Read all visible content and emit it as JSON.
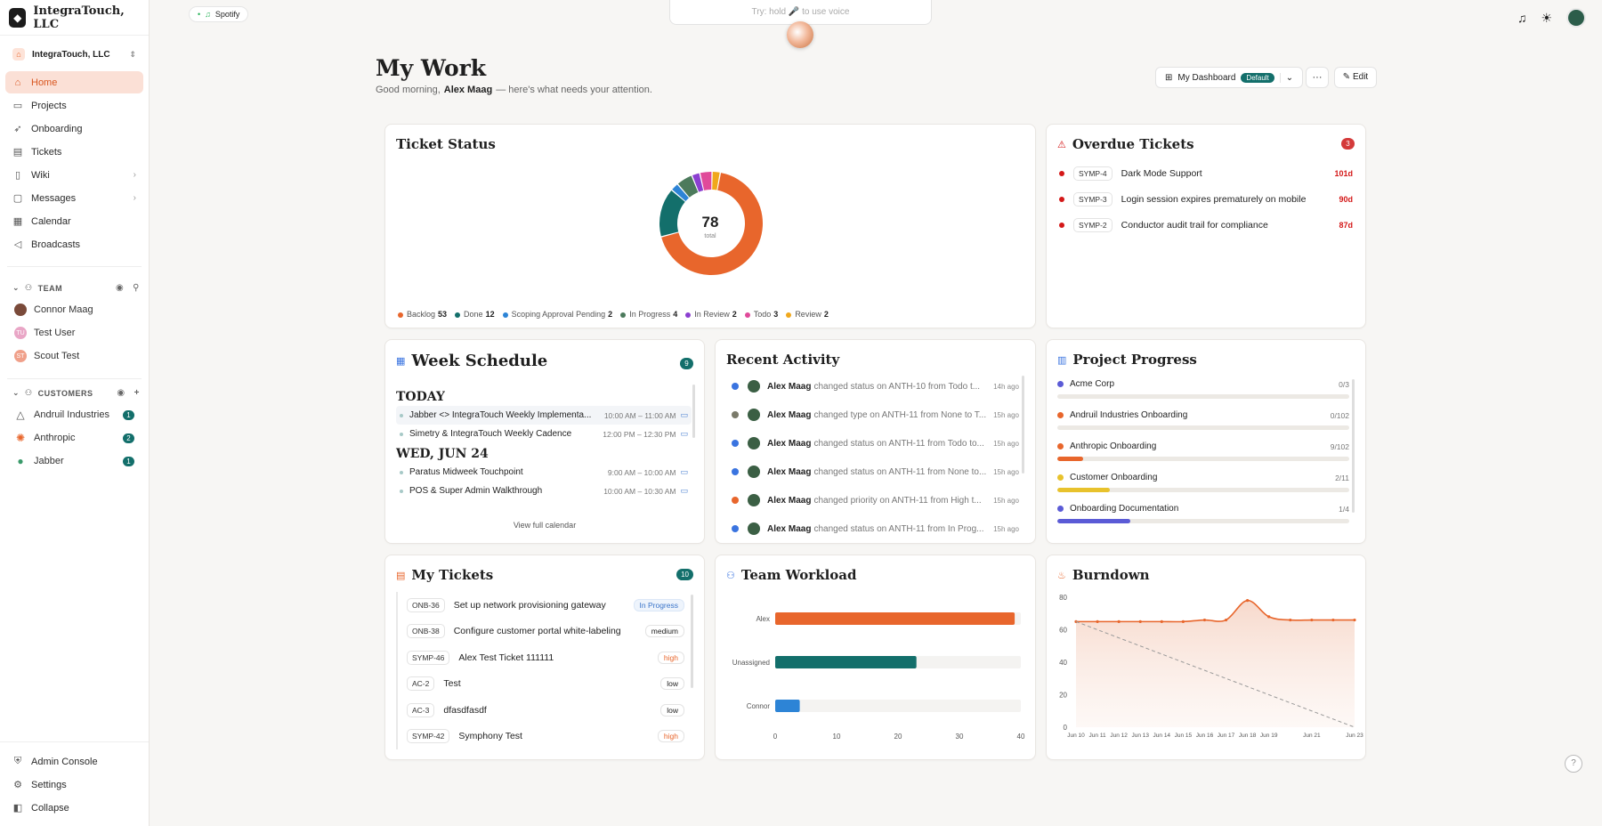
{
  "brand": {
    "name": "IntegraTouch, LLC"
  },
  "org": {
    "name": "IntegraTouch, LLC"
  },
  "nav": [
    {
      "label": "Home",
      "icon": "home-icon",
      "active": true
    },
    {
      "label": "Projects",
      "icon": "folder-icon"
    },
    {
      "label": "Onboarding",
      "icon": "rocket-icon"
    },
    {
      "label": "Tickets",
      "icon": "ticket-icon"
    },
    {
      "label": "Wiki",
      "icon": "book-icon",
      "arrow": true
    },
    {
      "label": "Messages",
      "icon": "message-icon",
      "arrow": true
    },
    {
      "label": "Calendar",
      "icon": "calendar-icon"
    },
    {
      "label": "Broadcasts",
      "icon": "megaphone-icon"
    }
  ],
  "team": {
    "label": "TEAM",
    "members": [
      {
        "name": "Connor Maag"
      },
      {
        "name": "Test User",
        "initials": "TU"
      },
      {
        "name": "Scout Test",
        "initials": "ST"
      }
    ]
  },
  "customers": {
    "label": "CUSTOMERS",
    "items": [
      {
        "name": "Andruil Industries",
        "count": "1"
      },
      {
        "name": "Anthropic",
        "count": "2"
      },
      {
        "name": "Jabber",
        "count": "1"
      }
    ]
  },
  "bottom_nav": [
    {
      "label": "Admin Console"
    },
    {
      "label": "Settings"
    },
    {
      "label": "Collapse"
    }
  ],
  "topbar": {
    "spotify": "Spotify",
    "voice_hint": "Try: hold 🎤 to use voice"
  },
  "header": {
    "title": "My Work",
    "greeting_pre": "Good morning,",
    "user": "Alex Maag",
    "greeting_post": "— here's what needs your attention.",
    "dashboard": "My Dashboard",
    "default": "Default",
    "more": "···",
    "edit": "Edit"
  },
  "ticket_status": {
    "title": "Ticket Status",
    "total": "78",
    "total_label": "total",
    "legend": [
      {
        "label": "Backlog",
        "count": "53",
        "color": "#e8662c"
      },
      {
        "label": "Done",
        "count": "12",
        "color": "#136f6b"
      },
      {
        "label": "Scoping Approval Pending",
        "count": "2",
        "color": "#2d84d6"
      },
      {
        "label": "In Progress",
        "count": "4",
        "color": "#4c7a5c"
      },
      {
        "label": "In Review",
        "count": "2",
        "color": "#8b3fd0"
      },
      {
        "label": "Todo",
        "count": "3",
        "color": "#e04a9a"
      },
      {
        "label": "Review",
        "count": "2",
        "color": "#f0a81c"
      }
    ]
  },
  "overdue": {
    "title": "Overdue Tickets",
    "count": "3",
    "items": [
      {
        "id": "SYMP-4",
        "title": "Dark Mode Support",
        "days": "101d"
      },
      {
        "id": "SYMP-3",
        "title": "Login session expires prematurely on mobile",
        "days": "90d"
      },
      {
        "id": "SYMP-2",
        "title": "Conductor audit trail for compliance",
        "days": "87d"
      }
    ]
  },
  "schedule": {
    "title": "Week Schedule",
    "count": "9",
    "days": [
      {
        "label": "TODAY",
        "events": [
          {
            "title": "Jabber <> IntegraTouch Weekly Implementa...",
            "time": "10:00 AM – 11:00 AM"
          },
          {
            "title": "Simetry & IntegraTouch Weekly Cadence",
            "time": "12:00 PM – 12:30 PM"
          }
        ]
      },
      {
        "label": "WED, JUN 24",
        "events": [
          {
            "title": "Paratus Midweek Touchpoint",
            "time": "9:00 AM – 10:00 AM"
          },
          {
            "title": "POS & Super Admin Walkthrough",
            "time": "10:00 AM – 10:30 AM"
          }
        ]
      }
    ],
    "view_all": "View full calendar"
  },
  "activity": {
    "title": "Recent Activity",
    "items": [
      {
        "user": "Alex Maag",
        "text": "changed status on ANTH-10 from Todo t...",
        "time": "14h ago",
        "color": "#3a74e0"
      },
      {
        "user": "Alex Maag",
        "text": "changed type on ANTH-11 from None to T...",
        "time": "15h ago",
        "color": "#7a7a6a"
      },
      {
        "user": "Alex Maag",
        "text": "changed status on ANTH-11 from Todo to...",
        "time": "15h ago",
        "color": "#3a74e0"
      },
      {
        "user": "Alex Maag",
        "text": "changed status on ANTH-11 from None to...",
        "time": "15h ago",
        "color": "#3a74e0"
      },
      {
        "user": "Alex Maag",
        "text": "changed priority on ANTH-11 from High t...",
        "time": "15h ago",
        "color": "#e8662c"
      },
      {
        "user": "Alex Maag",
        "text": "changed status on ANTH-11 from In Prog...",
        "time": "15h ago",
        "color": "#3a74e0"
      }
    ]
  },
  "progress": {
    "title": "Project Progress",
    "items": [
      {
        "name": "Acme Corp",
        "count": "0/3",
        "ratio": 0,
        "color": "#5b5bd6"
      },
      {
        "name": "Andruil Industries Onboarding",
        "count": "0/102",
        "ratio": 0,
        "color": "#e8662c"
      },
      {
        "name": "Anthropic Onboarding",
        "count": "9/102",
        "ratio": 0.088,
        "color": "#e8662c"
      },
      {
        "name": "Customer Onboarding",
        "count": "2/11",
        "ratio": 0.18,
        "color": "#e8c22c"
      },
      {
        "name": "Onboarding Documentation",
        "count": "1/4",
        "ratio": 0.25,
        "color": "#5b5bd6"
      }
    ]
  },
  "my_tickets": {
    "title": "My Tickets",
    "count": "10",
    "items": [
      {
        "id": "ONB-36",
        "title": "Set up network provisioning gateway",
        "priority": "In Progress",
        "kind": "prog"
      },
      {
        "id": "ONB-38",
        "title": "Configure customer portal white-labeling",
        "priority": "medium",
        "kind": "med"
      },
      {
        "id": "SYMP-46",
        "title": "Alex Test Ticket 111111",
        "priority": "high",
        "kind": "high"
      },
      {
        "id": "AC-2",
        "title": "Test",
        "priority": "low",
        "kind": "low"
      },
      {
        "id": "AC-3",
        "title": "dfasdfasdf",
        "priority": "low",
        "kind": "low"
      },
      {
        "id": "SYMP-42",
        "title": "Symphony Test",
        "priority": "high",
        "kind": "high"
      }
    ]
  },
  "workload": {
    "title": "Team Workload",
    "chart_data": {
      "type": "bar",
      "orientation": "horizontal",
      "categories": [
        "Alex",
        "Unassigned",
        "Connor"
      ],
      "values": [
        39,
        23,
        4
      ],
      "colors": [
        "#e8662c",
        "#136f6b",
        "#2d84d6"
      ],
      "xlim": [
        0,
        40
      ],
      "xticks": [
        "0",
        "10",
        "20",
        "30",
        "40"
      ]
    }
  },
  "burndown": {
    "title": "Burndown",
    "chart_data": {
      "type": "area",
      "x": [
        "Jun 10",
        "Jun 11",
        "Jun 12",
        "Jun 13",
        "Jun 14",
        "Jun 15",
        "Jun 16",
        "Jun 17",
        "Jun 18",
        "Jun 19",
        "Jun 20",
        "Jun 21",
        "Jun 22",
        "Jun 23"
      ],
      "xticks_shown": [
        "Jun 10",
        "Jun 11",
        "Jun 12",
        "Jun 13",
        "Jun 14",
        "Jun 15",
        "Jun 16",
        "Jun 17",
        "Jun 18",
        "Jun 19",
        "Jun 21",
        "Jun 23"
      ],
      "series": [
        {
          "values": [
            65,
            65,
            65,
            65,
            65,
            65,
            66,
            66,
            78,
            68,
            66,
            66,
            66,
            66
          ],
          "color": "#e8662c"
        },
        {
          "values": [
            65,
            60,
            55,
            50,
            45,
            40,
            35,
            30,
            25,
            20,
            15,
            10,
            5,
            0
          ],
          "color": "#9a9a9a",
          "dashed": true
        }
      ],
      "ylim": [
        0,
        80
      ],
      "yticks": [
        "0",
        "20",
        "40",
        "60",
        "80"
      ]
    }
  }
}
